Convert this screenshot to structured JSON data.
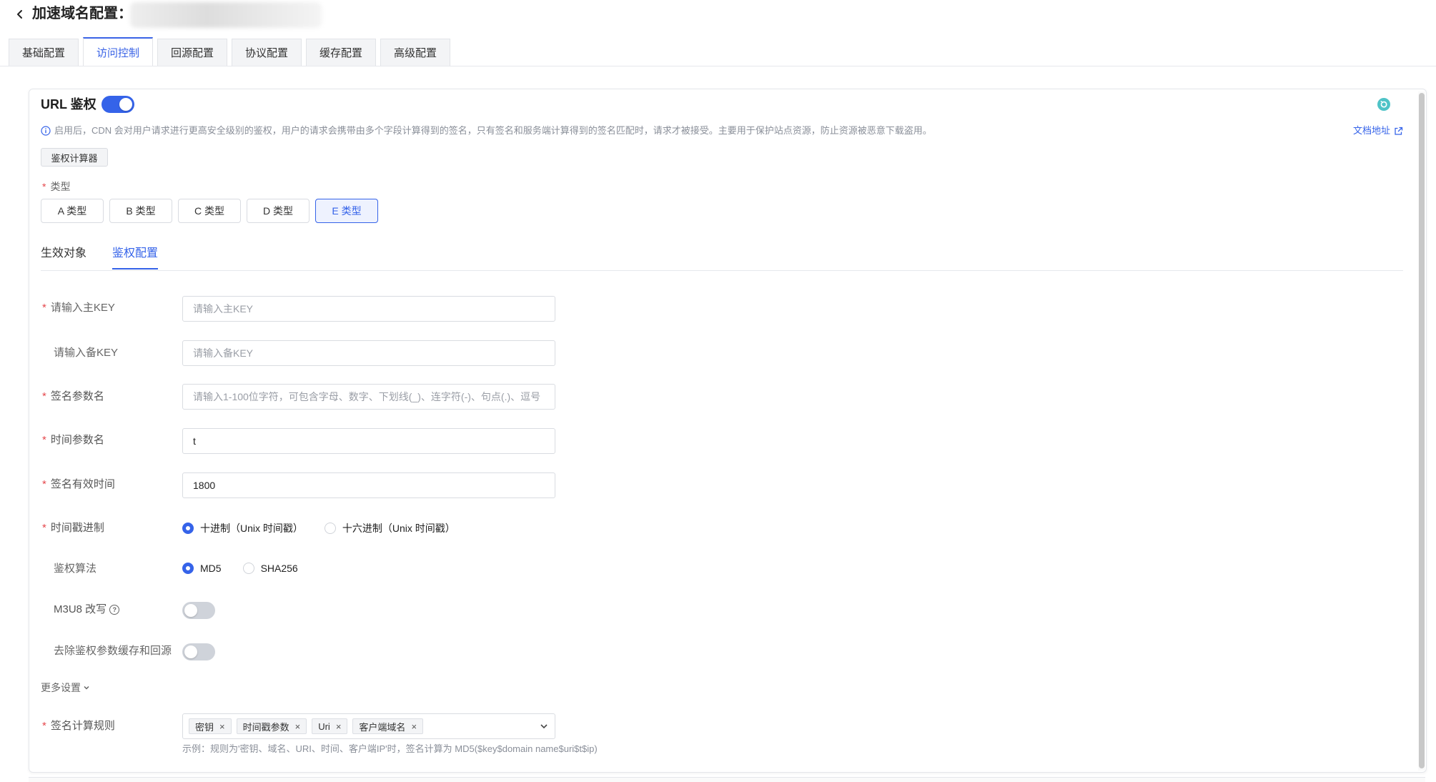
{
  "header": {
    "title": "加速域名配置："
  },
  "tabs": [
    "基础配置",
    "访问控制",
    "回源配置",
    "协议配置",
    "缓存配置",
    "高级配置"
  ],
  "section": {
    "title": "URL 鉴权",
    "enabled": true,
    "info": "启用后，CDN 会对用户请求进行更高安全级别的鉴权，用户的请求会携带由多个字段计算得到的签名，只有签名和服务端计算得到的签名匹配时，请求才被接受。主要用于保护站点资源，防止资源被恶意下载盗用。",
    "doc_link": "文档地址",
    "calc_button": "鉴权计算器"
  },
  "type": {
    "label": "类型",
    "options": [
      "A 类型",
      "B 类型",
      "C 类型",
      "D 类型",
      "E 类型"
    ],
    "selected": "E 类型"
  },
  "subtabs": [
    "生效对象",
    "鉴权配置"
  ],
  "form": {
    "primary_key": {
      "label": "请输入主KEY",
      "placeholder": "请输入主KEY",
      "value": ""
    },
    "backup_key": {
      "label": "请输入备KEY",
      "placeholder": "请输入备KEY",
      "value": ""
    },
    "sign_param": {
      "label": "签名参数名",
      "placeholder": "请输入1-100位字符，可包含字母、数字、下划线(_)、连字符(-)、句点(.)、逗号",
      "value": ""
    },
    "time_param": {
      "label": "时间参数名",
      "value": "t"
    },
    "valid_time": {
      "label": "签名有效时间",
      "value": "1800"
    },
    "timestamp_base": {
      "label": "时间戳进制",
      "options": [
        "十进制（Unix 时间戳）",
        "十六进制（Unix 时间戳）"
      ],
      "selected": "十进制（Unix 时间戳）"
    },
    "algorithm": {
      "label": "鉴权算法",
      "options": [
        "MD5",
        "SHA256"
      ],
      "selected": "MD5"
    },
    "m3u8": {
      "label": "M3U8 改写",
      "help": "?",
      "enabled": false
    },
    "strip_params": {
      "label": "去除鉴权参数缓存和回源",
      "enabled": false
    },
    "more": "更多设置",
    "sign_rule": {
      "label": "签名计算规则",
      "tags": [
        "密钥",
        "时间戳参数",
        "Uri",
        "客户端域名"
      ],
      "example": "示例：规则为'密钥、域名、URI、时间、客户端IP'时，签名计算为 MD5($key$domain name$uri$t$ip)"
    }
  },
  "colors": {
    "accent": "#3563e9",
    "required": "#e5484d",
    "refresh": "#4fc3c7"
  }
}
